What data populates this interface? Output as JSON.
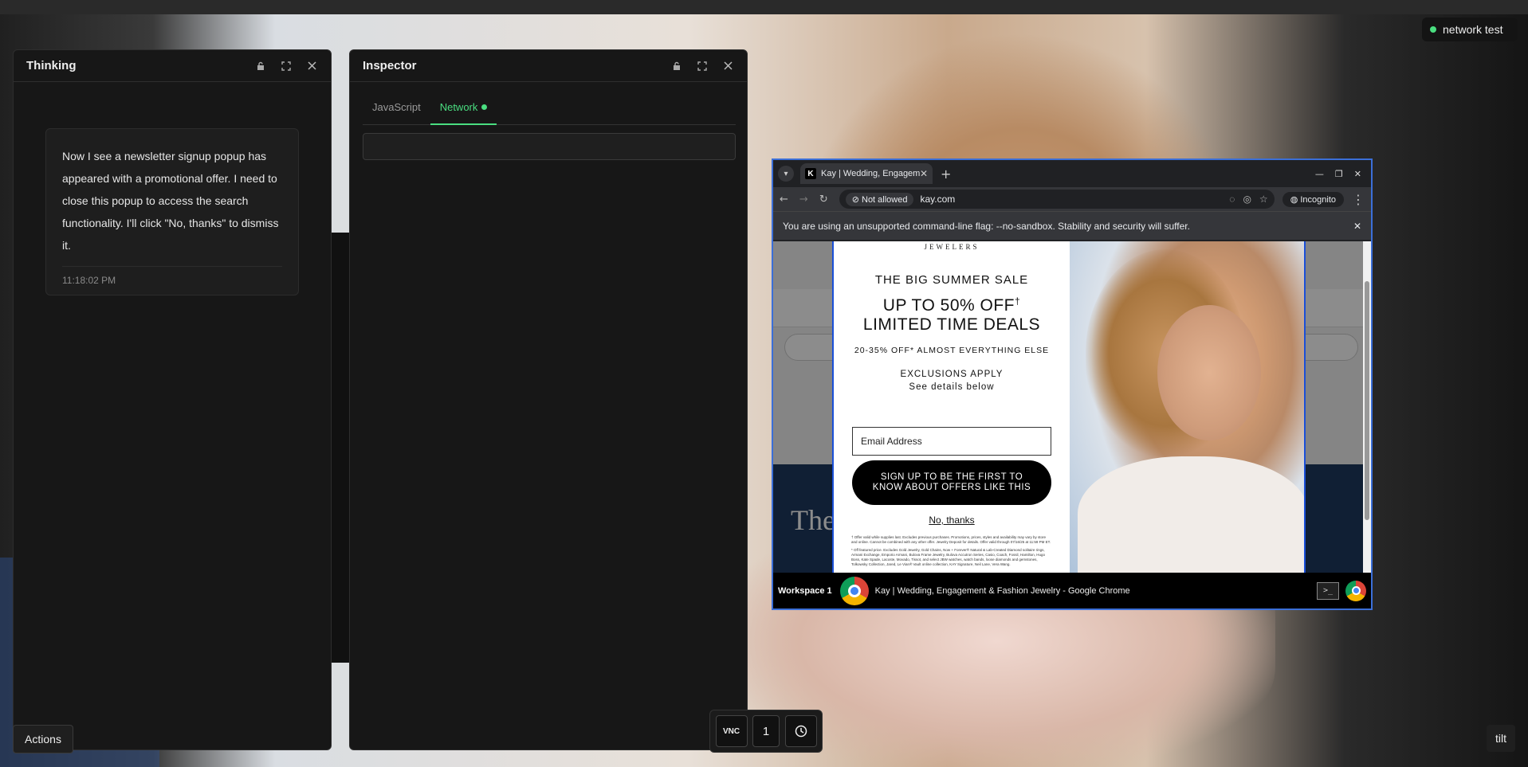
{
  "status": {
    "label": "network test",
    "color": "#4ade80"
  },
  "thinking": {
    "title": "Thinking",
    "message": "Now I see a newsletter signup popup has appeared with a promotional offer. I need to close this popup to access the search functionality. I'll click \"No, thanks\" to dismiss it.",
    "time": "11:18:02 PM",
    "icons": [
      "lock-icon",
      "expand-icon",
      "close-icon"
    ]
  },
  "inspector": {
    "title": "Inspector",
    "tabs": [
      {
        "label": "JavaScript",
        "active": false
      },
      {
        "label": "Network",
        "active": true
      }
    ],
    "filter_value": ""
  },
  "browser": {
    "tab_title": "Kay | Wedding, Engageme",
    "favicon": "K",
    "security_chip": "Not allowed",
    "url": "kay.com",
    "incognito_label": "Incognito",
    "infobar": "You are using an unsupported command-line flag: --no-sandbox. Stability and security will suffer.",
    "page": {
      "brand": "JEWELERS",
      "heading": "The Sal",
      "popup": {
        "line1": "THE BIG SUMMER SALE",
        "line2": "UP TO 50% OFF",
        "dagger": "†",
        "line3": "LIMITED TIME DEALS",
        "line4": "20-35% OFF* ALMOST EVERYTHING ELSE",
        "line5": "EXCLUSIONS APPLY",
        "line6": "See details below",
        "email_placeholder": "Email Address",
        "signup": "SIGN UP TO BE THE FIRST TO KNOW ABOUT OFFERS LIKE THIS",
        "no_thanks": "No, thanks",
        "fine1": "† Offer valid while supplies last. Excludes previous purchases. Promotions, prices, styles and availability may vary by store and online. Cannot be combined with any other offer. Jewelry Deposit for details. Offer valid through 07/16/25 at 11:59 PM ET.",
        "fine2": "* Off featured price. Excludes Gold Jewelry, Gold Chains, Now + Forever® Natural & Lab-Created Diamond solitaire rings, Armani Exchange, Emporio Armani, Bulova Frame Jewelry, Bulova Accutron Series, Casio, Coach, Fossil, Hamilton, Hugo Boss, Kate Spade, Lacoste, Movado, Tissot, and select JBW watches, watch bands, loose diamonds and gemstones, Tolkowsky Collection, Jared, Le Vian® Vault online collection, KAY Signature, Neil Lane, Vera Wang."
      }
    },
    "taskbar": {
      "workspace": "Workspace 1",
      "title": "Kay | Wedding, Engagement & Fashion Jewelry - Google Chrome"
    }
  },
  "toolbar": {
    "vnc": "VNC",
    "count": "1"
  },
  "actions_label": "Actions",
  "tilt_label": "tilt"
}
